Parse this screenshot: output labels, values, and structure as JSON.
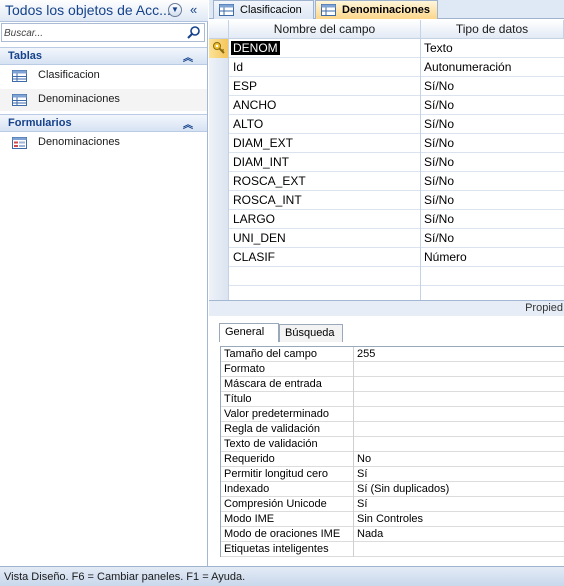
{
  "nav": {
    "title": "Todos los objetos de Acc...",
    "dropdown_icon": "chevron-down-circle-icon",
    "collapse_icon": "double-chevron-left-icon",
    "search": {
      "placeholder": "Buscar...",
      "icon": "search-icon"
    },
    "groups": [
      {
        "label": "Tablas",
        "items": [
          {
            "label": "Clasificacion",
            "icon": "table-icon"
          },
          {
            "label": "Denominaciones",
            "icon": "table-icon"
          }
        ]
      },
      {
        "label": "Formularios",
        "items": [
          {
            "label": "Denominaciones",
            "icon": "form-icon"
          }
        ]
      }
    ]
  },
  "tabs": [
    {
      "label": "Clasificacion",
      "icon": "table-icon"
    },
    {
      "label": "Denominaciones",
      "icon": "table-icon"
    }
  ],
  "grid": {
    "headers": {
      "name": "Nombre del campo",
      "type": "Tipo de datos"
    },
    "rows": [
      {
        "name": "DENOM",
        "type": "Texto"
      },
      {
        "name": "Id",
        "type": "Autonumeración"
      },
      {
        "name": "ESP",
        "type": "Sí/No"
      },
      {
        "name": "ANCHO",
        "type": "Sí/No"
      },
      {
        "name": "ALTO",
        "type": "Sí/No"
      },
      {
        "name": "DIAM_EXT",
        "type": "Sí/No"
      },
      {
        "name": "DIAM_INT",
        "type": "Sí/No"
      },
      {
        "name": "ROSCA_EXT",
        "type": "Sí/No"
      },
      {
        "name": "ROSCA_INT",
        "type": "Sí/No"
      },
      {
        "name": "LARGO",
        "type": "Sí/No"
      },
      {
        "name": "UNI_DEN",
        "type": "Sí/No"
      },
      {
        "name": "CLASIF",
        "type": "Número"
      }
    ]
  },
  "properties": {
    "bar_label": "Propied",
    "tabs": {
      "general": "General",
      "busqueda": "Búsqueda"
    },
    "rows": [
      {
        "label": "Tamaño del campo",
        "value": "255"
      },
      {
        "label": "Formato",
        "value": ""
      },
      {
        "label": "Máscara de entrada",
        "value": ""
      },
      {
        "label": "Título",
        "value": ""
      },
      {
        "label": "Valor predeterminado",
        "value": ""
      },
      {
        "label": "Regla de validación",
        "value": ""
      },
      {
        "label": "Texto de validación",
        "value": ""
      },
      {
        "label": "Requerido",
        "value": "No"
      },
      {
        "label": "Permitir longitud cero",
        "value": "Sí"
      },
      {
        "label": "Indexado",
        "value": "Sí (Sin duplicados)"
      },
      {
        "label": "Compresión Unicode",
        "value": "Sí"
      },
      {
        "label": "Modo IME",
        "value": "Sin Controles"
      },
      {
        "label": "Modo de oraciones IME",
        "value": "Nada"
      },
      {
        "label": "Etiquetas inteligentes",
        "value": ""
      }
    ]
  },
  "status": {
    "text": "Vista Diseño.  F6 = Cambiar paneles.  F1 = Ayuda."
  },
  "colors": {
    "accent": "#15428b",
    "active_tab": "#fcd68a",
    "pane_border": "#a5b8d3"
  }
}
